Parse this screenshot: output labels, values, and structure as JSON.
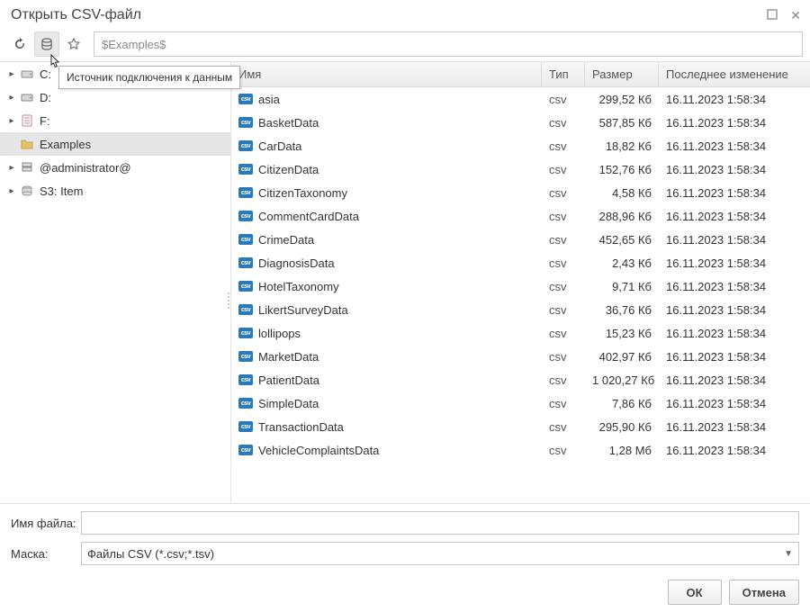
{
  "window": {
    "title": "Открыть CSV-файл"
  },
  "toolbar": {
    "path_placeholder": "$Examples$",
    "tooltip_text": "Источник подключения к данным"
  },
  "sidebar": {
    "items": [
      {
        "label": "C:",
        "expandable": true,
        "icon": "drive"
      },
      {
        "label": "D:",
        "expandable": true,
        "icon": "drive"
      },
      {
        "label": "F:",
        "expandable": true,
        "icon": "doc"
      },
      {
        "label": "Examples",
        "expandable": false,
        "icon": "folder",
        "selected": true
      },
      {
        "label": "@administrator@",
        "expandable": true,
        "icon": "server"
      },
      {
        "label": "S3: Item",
        "expandable": true,
        "icon": "cloud"
      }
    ]
  },
  "columns": {
    "name": "Имя",
    "type": "Тип",
    "size": "Размер",
    "date": "Последнее изменение"
  },
  "files": [
    {
      "name": "asia",
      "type": "csv",
      "size": "299,52 Кб",
      "date": "16.11.2023 1:58:34"
    },
    {
      "name": "BasketData",
      "type": "csv",
      "size": "587,85 Кб",
      "date": "16.11.2023 1:58:34"
    },
    {
      "name": "CarData",
      "type": "csv",
      "size": "18,82 Кб",
      "date": "16.11.2023 1:58:34"
    },
    {
      "name": "CitizenData",
      "type": "csv",
      "size": "152,76 Кб",
      "date": "16.11.2023 1:58:34"
    },
    {
      "name": "CitizenTaxonomy",
      "type": "csv",
      "size": "4,58 Кб",
      "date": "16.11.2023 1:58:34"
    },
    {
      "name": "CommentCardData",
      "type": "csv",
      "size": "288,96 Кб",
      "date": "16.11.2023 1:58:34"
    },
    {
      "name": "CrimeData",
      "type": "csv",
      "size": "452,65 Кб",
      "date": "16.11.2023 1:58:34"
    },
    {
      "name": "DiagnosisData",
      "type": "csv",
      "size": "2,43 Кб",
      "date": "16.11.2023 1:58:34"
    },
    {
      "name": "HotelTaxonomy",
      "type": "csv",
      "size": "9,71 Кб",
      "date": "16.11.2023 1:58:34"
    },
    {
      "name": "LikertSurveyData",
      "type": "csv",
      "size": "36,76 Кб",
      "date": "16.11.2023 1:58:34"
    },
    {
      "name": "lollipops",
      "type": "csv",
      "size": "15,23 Кб",
      "date": "16.11.2023 1:58:34"
    },
    {
      "name": "MarketData",
      "type": "csv",
      "size": "402,97 Кб",
      "date": "16.11.2023 1:58:34"
    },
    {
      "name": "PatientData",
      "type": "csv",
      "size": "1 020,27 Кб",
      "date": "16.11.2023 1:58:34"
    },
    {
      "name": "SimpleData",
      "type": "csv",
      "size": "7,86 Кб",
      "date": "16.11.2023 1:58:34"
    },
    {
      "name": "TransactionData",
      "type": "csv",
      "size": "295,90 Кб",
      "date": "16.11.2023 1:58:34"
    },
    {
      "name": "VehicleComplaintsData",
      "type": "csv",
      "size": "1,28 Мб",
      "date": "16.11.2023 1:58:34"
    }
  ],
  "form": {
    "filename_label": "Имя файла:",
    "filename_value": "",
    "mask_label": "Маска:",
    "mask_value": "Файлы CSV (*.csv;*.tsv)"
  },
  "buttons": {
    "ok": "ОК",
    "cancel": "Отмена"
  }
}
